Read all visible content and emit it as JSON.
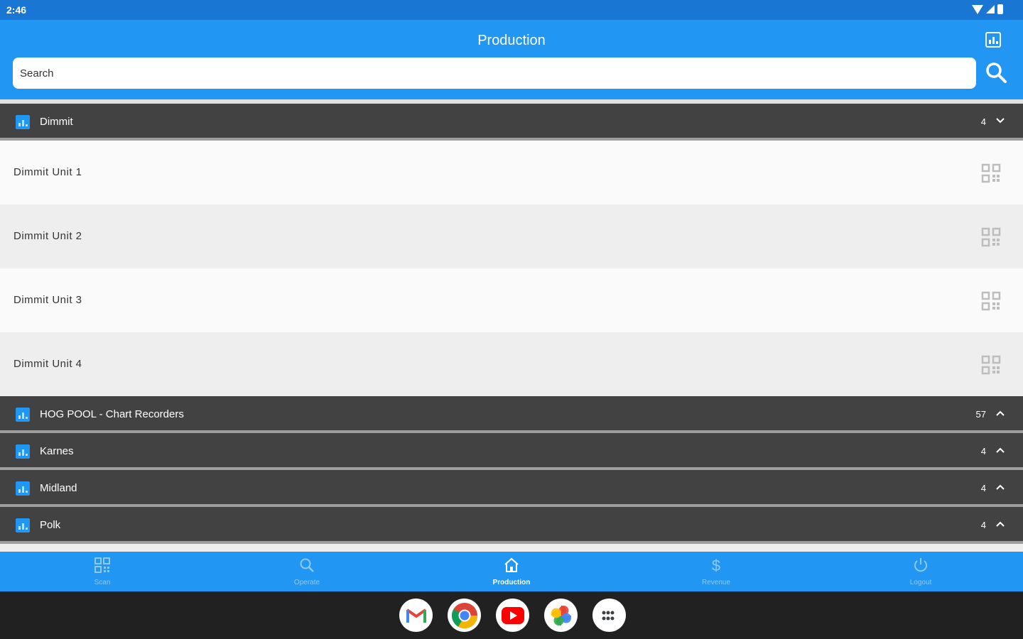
{
  "status_bar": {
    "time": "2:46"
  },
  "app_bar": {
    "title": "Production",
    "search_placeholder": "Search"
  },
  "groups": [
    {
      "name": "Dimmit",
      "count": "4",
      "expanded": true,
      "units": [
        "Dimmit Unit 1",
        "Dimmit Unit 2",
        "Dimmit Unit 3",
        "Dimmit Unit 4"
      ]
    },
    {
      "name": "HOG POOL - Chart Recorders",
      "count": "57",
      "expanded": false
    },
    {
      "name": "Karnes",
      "count": "4",
      "expanded": false
    },
    {
      "name": "Midland",
      "count": "4",
      "expanded": false
    },
    {
      "name": "Polk",
      "count": "4",
      "expanded": false
    }
  ],
  "bottom_nav": {
    "items": [
      {
        "label": "Scan",
        "icon": "qr-code-icon",
        "active": false
      },
      {
        "label": "Operate",
        "icon": "search-icon",
        "active": false
      },
      {
        "label": "Production",
        "icon": "home-icon",
        "active": true
      },
      {
        "label": "Revenue",
        "icon": "dollar-icon",
        "active": false
      },
      {
        "label": "Logout",
        "icon": "power-icon",
        "active": false
      }
    ]
  },
  "dock": {
    "apps": [
      {
        "icon": "gmail-icon"
      },
      {
        "icon": "chrome-icon"
      },
      {
        "icon": "youtube-icon"
      },
      {
        "icon": "photos-icon"
      },
      {
        "icon": "app-drawer-icon"
      }
    ]
  },
  "colors": {
    "primary": "#2196f3",
    "status_bar": "#1976d2",
    "group_header": "#424242"
  }
}
